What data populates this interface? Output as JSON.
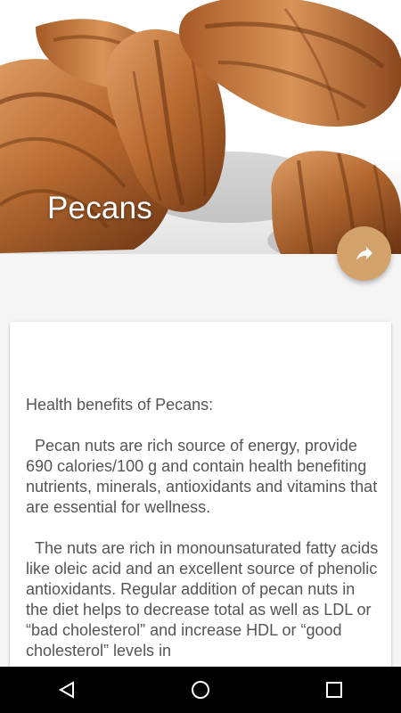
{
  "hero": {
    "title": "Pecans",
    "image_subject": "pecan nuts photo"
  },
  "status_bar": {
    "icons": [
      "signal-icon",
      "battery-icon"
    ]
  },
  "toolbar": {
    "back_icon": "arrow-left-icon",
    "share_icon": "share-icon",
    "accent_color": "#d3a26a"
  },
  "article": {
    "heading": "Health benefits of Pecans:",
    "paragraphs": [
      "Pecan nuts are rich source of energy, provide 690 calories/100 g and contain health benefiting nutrients, minerals, antioxidants and vitamins that are essential for wellness.",
      "The nuts are rich in monounsaturated fatty acids like oleic acid and an excellent source of phenolic antioxidants. Regular addition of pecan nuts in the diet helps to decrease total as well as LDL or “bad cholesterol” and increase HDL or “good cholesterol” levels in"
    ]
  },
  "nav_bar": {
    "back": "nav-back-icon",
    "home": "nav-home-icon",
    "recents": "nav-recents-icon"
  }
}
